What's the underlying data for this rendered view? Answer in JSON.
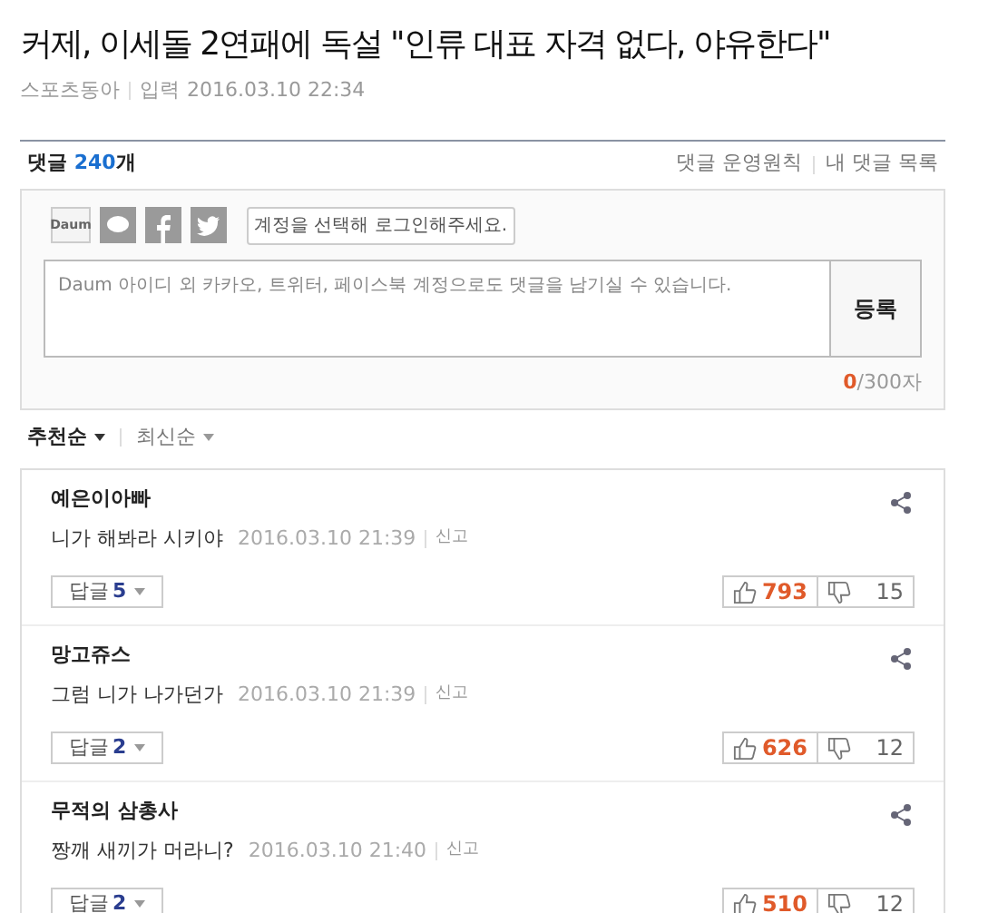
{
  "article": {
    "title": "커제, 이세돌 2연패에 독설 \"인류 대표 자격 없다, 야유한다\"",
    "source": "스포츠동아",
    "input_label": "입력",
    "datetime": "2016.03.10 22:34"
  },
  "comments_header": {
    "label": "댓글",
    "count": "240",
    "unit": "개",
    "links": [
      "댓글 운영원칙",
      "내 댓글 목록"
    ]
  },
  "login": {
    "services": [
      {
        "kind": "daum",
        "label": "Daum"
      },
      {
        "kind": "kakao"
      },
      {
        "kind": "facebook"
      },
      {
        "kind": "twitter"
      }
    ],
    "tooltip": "계정을 선택해 로그인해주세요."
  },
  "editor": {
    "placeholder": "Daum 아이디 외 카카오, 트위터, 페이스북 계정으로도 댓글을 남기실 수 있습니다.",
    "submit": "등록",
    "count": "0",
    "limit": "/300자"
  },
  "sort": [
    {
      "label": "추천순",
      "selected": true
    },
    {
      "label": "최신순",
      "selected": false
    }
  ],
  "comments": [
    {
      "author": "예은이아빠",
      "text": "니가 해봐라 시키야",
      "datetime": "2016.03.10 21:39",
      "report": "신고",
      "reply_label": "답글",
      "reply_count": "5",
      "likes": "793",
      "dislikes": "15"
    },
    {
      "author": "망고쥬스",
      "text": "그럼 니가 나가던가",
      "datetime": "2016.03.10 21:39",
      "report": "신고",
      "reply_label": "답글",
      "reply_count": "2",
      "likes": "626",
      "dislikes": "12"
    },
    {
      "author": "무적의 삼총사",
      "text": "짱깨 새끼가 머라니?",
      "datetime": "2016.03.10 21:40",
      "report": "신고",
      "reply_label": "답글",
      "reply_count": "2",
      "likes": "510",
      "dislikes": "12"
    }
  ]
}
